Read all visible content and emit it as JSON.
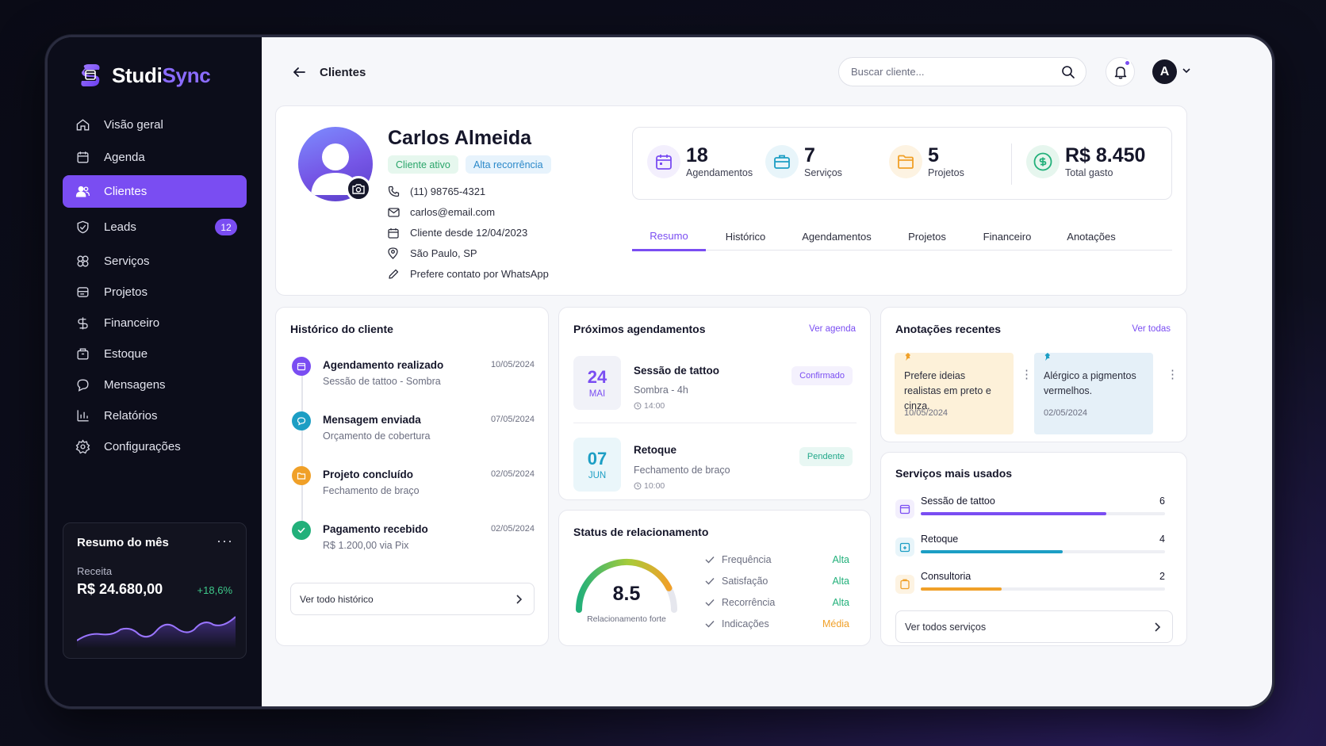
{
  "brand": {
    "name_part1": "Studi",
    "name_part2": "Sync"
  },
  "sidebar": {
    "items": [
      {
        "label": "Visão geral",
        "icon": "home-icon"
      },
      {
        "label": "Agenda",
        "icon": "calendar-icon"
      },
      {
        "label": "Clientes",
        "icon": "users-icon",
        "active": true
      },
      {
        "label": "Leads",
        "icon": "leads-icon",
        "badge": "12"
      },
      {
        "label": "Serviços",
        "icon": "services-icon"
      },
      {
        "label": "Projetos",
        "icon": "projects-icon"
      },
      {
        "label": "Financeiro",
        "icon": "finance-icon"
      },
      {
        "label": "Estoque",
        "icon": "box-icon"
      },
      {
        "label": "Mensagens",
        "icon": "message-icon"
      },
      {
        "label": "Relatórios",
        "icon": "chart-icon"
      },
      {
        "label": "Configurações",
        "icon": "settings-icon"
      }
    ],
    "month_summary": {
      "title": "Resumo do mês",
      "more": "···",
      "label": "Receita",
      "value": "R$ 24.680,00",
      "delta": "+18,6%"
    }
  },
  "header": {
    "title": "Clientes",
    "search_placeholder": "Buscar cliente...",
    "avatar_letter": "A"
  },
  "client": {
    "name": "Carlos Almeida",
    "tags": [
      "Cliente ativo",
      "Alta recorrência"
    ],
    "phone": "(11) 98765-4321",
    "email": "carlos@email.com",
    "since": "Cliente desde 12/04/2023",
    "location": "São Paulo, SP",
    "preference": "Prefere contato por WhatsApp"
  },
  "stats": [
    {
      "value": "18",
      "label": "Agendamentos",
      "icon": "calendar-icon",
      "color": "#7a4df2"
    },
    {
      "value": "7",
      "label": "Serviços",
      "icon": "briefcase-icon",
      "color": "#1c9ec4"
    },
    {
      "value": "5",
      "label": "Projetos",
      "icon": "folder-icon",
      "color": "#f0a028"
    },
    {
      "value": "R$ 8.450",
      "label": "Total gasto",
      "icon": "dollar-icon",
      "color": "#22b07a"
    }
  ],
  "tabs": [
    "Resumo",
    "Histórico",
    "Agendamentos",
    "Projetos",
    "Financeiro",
    "Anotações"
  ],
  "history": {
    "title": "Histórico do cliente",
    "items": [
      {
        "title": "Agendamento realizado",
        "sub": "Sessão de tattoo - Sombra",
        "date": "10/05/2024",
        "color": "#7a4df2"
      },
      {
        "title": "Mensagem enviada",
        "sub": "Orçamento de cobertura",
        "date": "07/05/2024",
        "color": "#1c9ec4"
      },
      {
        "title": "Projeto concluído",
        "sub": "Fechamento de braço",
        "date": "02/05/2024",
        "color": "#f0a028"
      },
      {
        "title": "Pagamento recebido",
        "sub": "R$ 1.200,00 via Pix",
        "date": "02/05/2024",
        "color": "#22b07a"
      }
    ],
    "button": "Ver todo histórico"
  },
  "appointments": {
    "title": "Próximos agendamentos",
    "link": "Ver agenda",
    "items": [
      {
        "day": "24",
        "month": "MAI",
        "title": "Sessão de tattoo",
        "sub": "Sombra - 4h",
        "time": "14:00",
        "status": "Confirmado"
      },
      {
        "day": "07",
        "month": "JUN",
        "title": "Retoque",
        "sub": "Fechamento de braço",
        "time": "10:00",
        "status": "Pendente"
      }
    ]
  },
  "relationship": {
    "title": "Status de relacionamento",
    "score": "8.5",
    "score_fraction": 0.85,
    "score_label": "Relacionamento forte",
    "rows": [
      {
        "label": "Frequência",
        "level": "Alta"
      },
      {
        "label": "Satisfação",
        "level": "Alta"
      },
      {
        "label": "Recorrência",
        "level": "Alta"
      },
      {
        "label": "Indicações",
        "level": "Média"
      }
    ]
  },
  "notes": {
    "title": "Anotações recentes",
    "link": "Ver todas",
    "items": [
      {
        "text": "Prefere ideias realistas em preto e cinza.",
        "date": "10/05/2024"
      },
      {
        "text": "Alérgico a pigmentos vermelhos.",
        "date": "02/05/2024"
      }
    ]
  },
  "services": {
    "title": "Serviços mais usados",
    "items": [
      {
        "name": "Sessão de tattoo",
        "count": "6",
        "fraction": 0.76,
        "color": "#7a4df2"
      },
      {
        "name": "Retoque",
        "count": "4",
        "fraction": 0.58,
        "color": "#1c9ec4"
      },
      {
        "name": "Consultoria",
        "count": "2",
        "fraction": 0.33,
        "color": "#f0a028"
      }
    ],
    "button": "Ver todos serviços"
  }
}
